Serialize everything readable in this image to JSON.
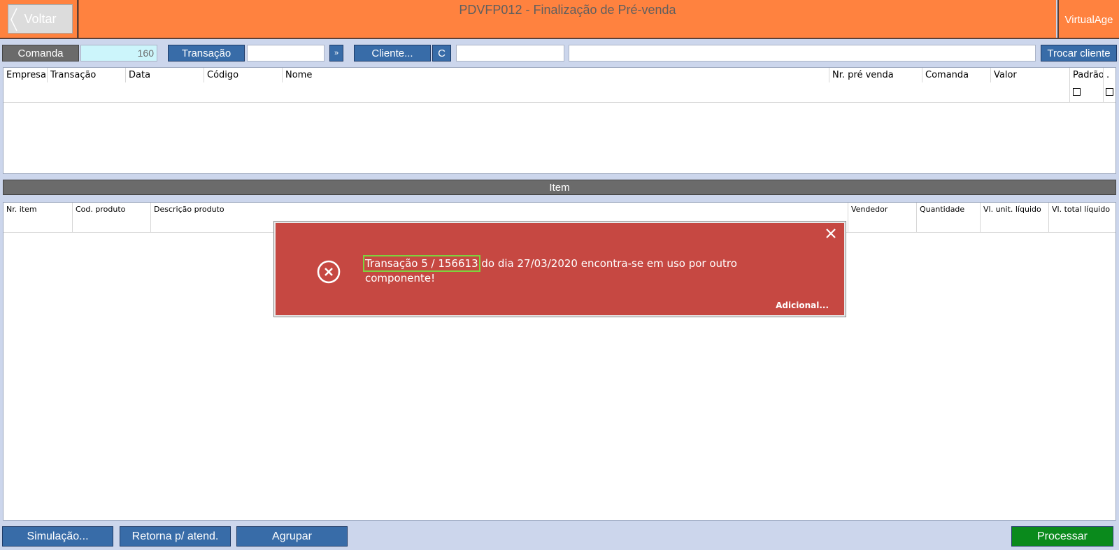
{
  "header": {
    "back_label": "Voltar",
    "title": "PDVFP012 - Finalização de Pré-venda",
    "brand": "VirtualAge"
  },
  "toolbar": {
    "comanda_label": "Comanda",
    "comanda_value": "160",
    "transacao_label": "Transação",
    "transacao_value": "",
    "next_label": "»",
    "cliente_label": "Cliente...",
    "clear_label": "C",
    "cliente_code": "",
    "cliente_name": "",
    "trocar_label": "Trocar cliente"
  },
  "grid_top": {
    "columns": [
      "Empresa",
      "Transação",
      "Data",
      "Código",
      "Nome",
      "Nr. pré venda",
      "Comanda",
      "Valor",
      "Padrão",
      "."
    ]
  },
  "section": {
    "label": "Item"
  },
  "grid_items": {
    "columns": [
      "Nr. item",
      "Cod. produto",
      "Descrição produto",
      "Vendedor",
      "Quantidade",
      "Vl. unit. líquido",
      "Vl. total líquido"
    ]
  },
  "dialog": {
    "highlight": "Transação 5 / 156613",
    "message_rest": " do dia 27/03/2020 encontra-se em uso por outro componente!",
    "more_label": "Adicional..."
  },
  "footer": {
    "simulacao_label": "Simulação...",
    "retorna_label": "Retorna p/ atend.",
    "agrupar_label": "Agrupar",
    "processar_label": "Processar"
  },
  "colors": {
    "header": "#ff823f",
    "primary_button": "#386ca8",
    "error_dialog": "#c64842",
    "confirm_button": "#0a8a1c"
  }
}
